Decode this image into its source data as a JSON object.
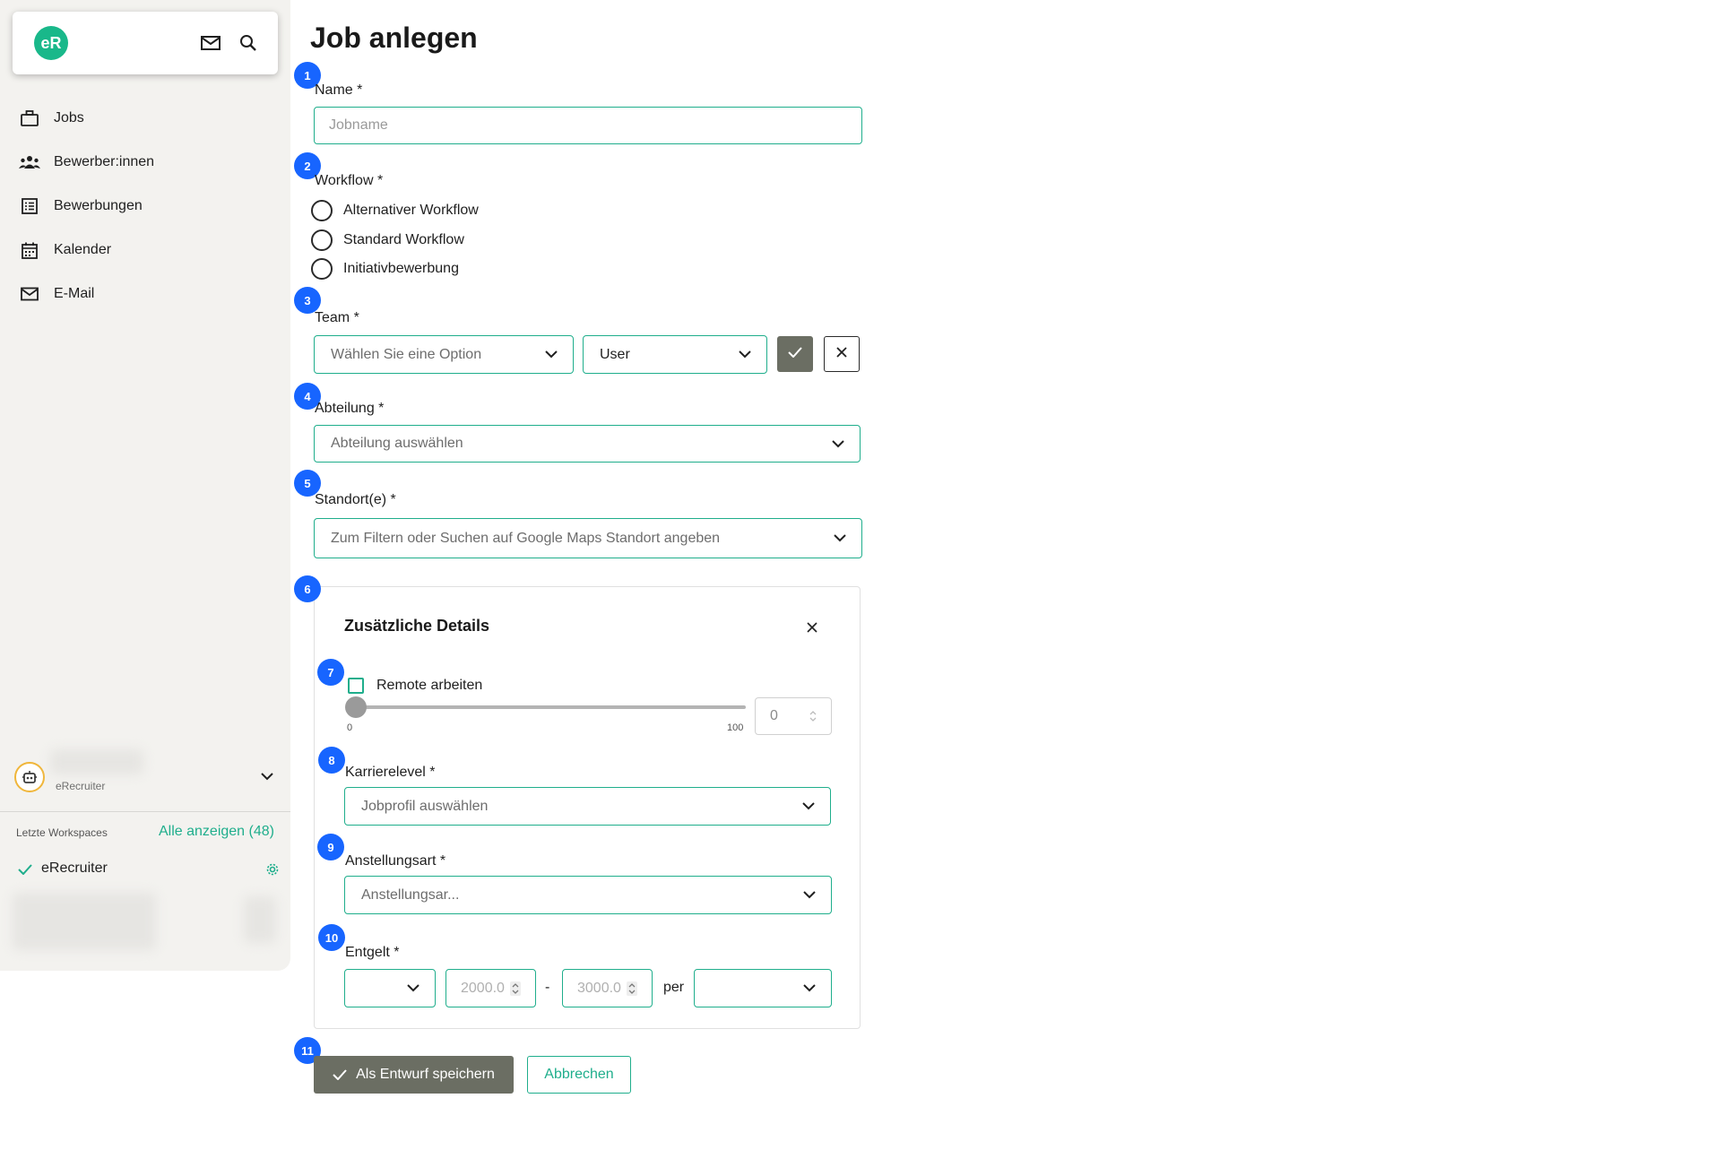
{
  "app": {
    "logo_text": "eR"
  },
  "sidebar": {
    "items": [
      {
        "label": "Jobs",
        "icon": "briefcase-icon"
      },
      {
        "label": "Bewerber:innen",
        "icon": "people-icon"
      },
      {
        "label": "Bewerbungen",
        "icon": "list-icon"
      },
      {
        "label": "Kalender",
        "icon": "calendar-icon"
      },
      {
        "label": "E-Mail",
        "icon": "mail-icon"
      }
    ],
    "account": {
      "subtitle": "eRecruiter"
    },
    "workspaces": {
      "heading": "Letzte Workspaces",
      "show_all": "Alle anzeigen (48)",
      "current": "eRecruiter"
    }
  },
  "page": {
    "title": "Job anlegen"
  },
  "form": {
    "badges": [
      "1",
      "2",
      "3",
      "4",
      "5",
      "6",
      "7",
      "8",
      "9",
      "10",
      "11"
    ],
    "name": {
      "label": "Name *",
      "placeholder": "Jobname"
    },
    "workflow": {
      "label": "Workflow *",
      "options": [
        "Alternativer Workflow",
        "Standard Workflow",
        "Initiativbewerbung"
      ]
    },
    "team": {
      "label": "Team *",
      "select_placeholder": "Wählen Sie eine Option",
      "role_value": "User"
    },
    "abteilung": {
      "label": "Abteilung *",
      "placeholder": "Abteilung auswählen"
    },
    "standort": {
      "label": "Standort(e) *",
      "placeholder": "Zum Filtern oder Suchen auf Google Maps Standort angeben"
    },
    "details": {
      "title": "Zusätzliche Details",
      "remote": {
        "label": "Remote arbeiten",
        "value": "0",
        "min": "0",
        "max": "100",
        "level": 0
      },
      "karriere": {
        "label": "Karrierelevel *",
        "placeholder": "Jobprofil auswählen"
      },
      "anstellung": {
        "label": "Anstellungsart *",
        "placeholder": "Anstellungsar..."
      },
      "entgelt": {
        "label": "Entgelt *",
        "from": "2000.0",
        "to": "3000.0",
        "dash": "-",
        "per": "per"
      }
    },
    "actions": {
      "save": "Als Entwurf speichern",
      "cancel": "Abbrechen"
    }
  }
}
